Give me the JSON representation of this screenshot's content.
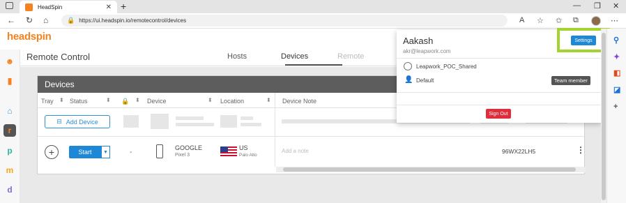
{
  "browser": {
    "tab_title": "HeadSpin",
    "url": "https://ui.headspin.io/remotecontrol/devices"
  },
  "app": {
    "logo": "headspin",
    "page_title": "Remote Control",
    "nav_tabs": [
      "Hosts",
      "Devices",
      "Remote"
    ],
    "active_tab": "Devices"
  },
  "devices_panel": {
    "title": "Devices",
    "columns": [
      "Tray",
      "Status",
      "Device",
      "Location",
      "Device Note"
    ],
    "add_device_label": "Add Device",
    "row": {
      "start_label": "Start",
      "status_dash": "-",
      "device_brand": "GOOGLE",
      "device_model": "Pixel 3",
      "country": "US",
      "city": "Palo Alto",
      "note_placeholder": "Add a note",
      "serial": "96WX22LH5"
    }
  },
  "account_menu": {
    "name": "Aakash",
    "email": "akr@leapwork.com",
    "org": "Leapwork_POC_Shared",
    "team": "Default",
    "role_badge": "Team member",
    "settings_label": "Settings",
    "signout_label": "Sign Out"
  },
  "colors": {
    "brand_orange": "#f58220",
    "primary_blue": "#1e88d6",
    "signout_red": "#e02d3c",
    "highlight_green": "#a4d22e"
  }
}
